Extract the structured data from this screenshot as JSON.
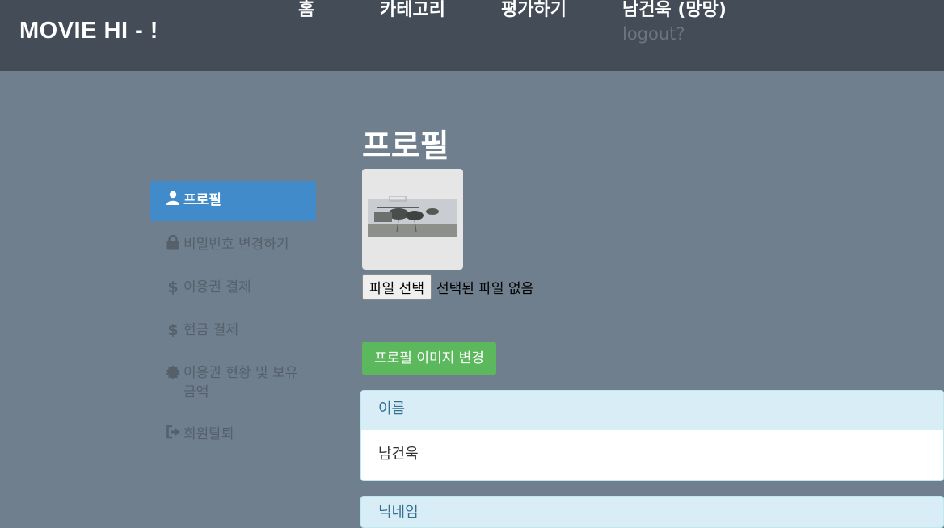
{
  "header": {
    "brand": "MOVIE HI - !",
    "nav": [
      "홈",
      "카테고리",
      "평가하기",
      "남건욱 (망망)"
    ],
    "logout": "logout?"
  },
  "sidebar": {
    "items": [
      {
        "label": "프로필",
        "icon": "user-icon",
        "active": true
      },
      {
        "label": "비밀번호 변경하기",
        "icon": "lock-icon"
      },
      {
        "label": "이용권 결제",
        "icon": "dollar-icon"
      },
      {
        "label": "현금 결제",
        "icon": "dollar-icon"
      },
      {
        "label": "이용권 현황 및 보유 금액",
        "icon": "certificate-icon"
      },
      {
        "label": "회원탈퇴",
        "icon": "logout-icon"
      }
    ]
  },
  "main": {
    "title": "프로필",
    "file_button": "파일 선택",
    "file_status": "선택된 파일 없음",
    "change_image_button": "프로필 이미지 변경",
    "panels": [
      {
        "heading": "이름",
        "value": "남건욱"
      },
      {
        "heading": "닉네임",
        "value": ""
      }
    ]
  },
  "colors": {
    "topbar": "#444d57",
    "background": "#6f7f8e",
    "active_item": "#428bca",
    "button_green": "#5cb85c",
    "panel_heading": "#d9edf7"
  }
}
